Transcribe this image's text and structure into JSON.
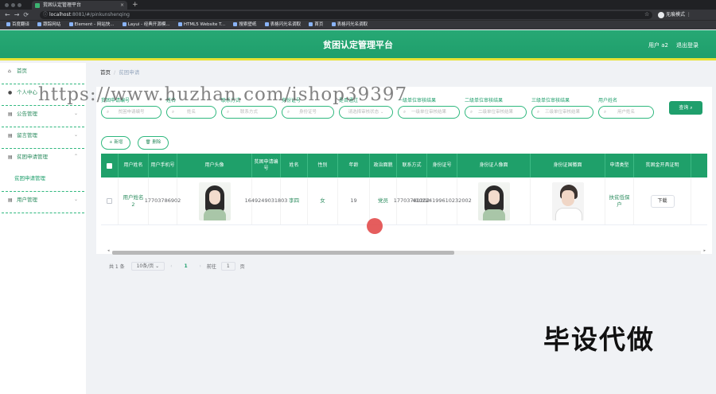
{
  "browser": {
    "tab_title": "贫困认定管理平台",
    "url_host": "localhost",
    "url_path": ":8081/#/pinkunshenqing",
    "profile_label": "无痕模式",
    "bookmarks": [
      "百度翻译",
      "跟踪网站",
      "Element - 网站快...",
      "Layui - 经典开源模...",
      "HTML5 Website T...",
      "搜索壁纸",
      "表格闪光名调取",
      "首页",
      "表格闪光名调取"
    ]
  },
  "header": {
    "title": "贫困认定管理平台",
    "user": "用户 a2",
    "logout": "退出登录"
  },
  "sidebar": {
    "items": [
      {
        "label": "首页",
        "icon": "home-icon"
      },
      {
        "label": "个人中心",
        "icon": "user-icon"
      },
      {
        "label": "公告管理",
        "icon": "notice-icon"
      },
      {
        "label": "留言管理",
        "icon": "message-icon"
      },
      {
        "label": "贫困申请管理",
        "icon": "folder-icon"
      },
      {
        "label": "贫困申请管理",
        "icon": ""
      },
      {
        "label": "用户管理",
        "icon": "users-icon"
      }
    ]
  },
  "breadcrumb": {
    "home": "首页",
    "current": "贫困申请"
  },
  "filters": [
    {
      "label": "贫困申请编号",
      "placeholder": "贫困申请编号"
    },
    {
      "label": "姓名",
      "placeholder": "姓名"
    },
    {
      "label": "联系方式",
      "placeholder": "联系方式"
    },
    {
      "label": "身份证号",
      "placeholder": "身份证号"
    },
    {
      "label": "是否通过",
      "placeholder": "请选择审核状态"
    },
    {
      "label": "一级单位审核结果",
      "placeholder": "一级单位审核结果"
    },
    {
      "label": "二级单位审核结果",
      "placeholder": "二级单位审核结果"
    },
    {
      "label": "三级单位审核结果",
      "placeholder": "三级单位审核结果"
    },
    {
      "label": "用户姓名",
      "placeholder": "用户姓名"
    }
  ],
  "buttons": {
    "search": "查询",
    "add": "新增",
    "delete": "删除",
    "download": "下载"
  },
  "table": {
    "columns": [
      "",
      "用户姓名",
      "用户手机号",
      "用户头像",
      "贫困申请编号",
      "姓名",
      "性别",
      "年龄",
      "政治面貌",
      "联系方式",
      "身份证号",
      "身份证人像面",
      "身份证国徽面",
      "申请类型",
      "贫困金开具证明"
    ],
    "rows": [
      {
        "user_name": "用户姓名2",
        "phone": "17703786902",
        "apply_no": "1649249031803",
        "name": "李四",
        "gender": "女",
        "age": "19",
        "politics": "党员",
        "contact": "17703781202",
        "id_no": "410224199610232002",
        "apply_type": "扶贫低保户"
      }
    ]
  },
  "pager": {
    "total": "共 1 条",
    "page_size": "10条/页",
    "page": "1",
    "goto_label": "前往",
    "goto_value": "1",
    "page_unit": "页"
  },
  "overlays": {
    "watermark": "https://www.huzhan.com/ishop39397",
    "stamp": "毕设代做"
  },
  "colors": {
    "accent": "#1f9f6c",
    "header_border": "#e8e234"
  }
}
